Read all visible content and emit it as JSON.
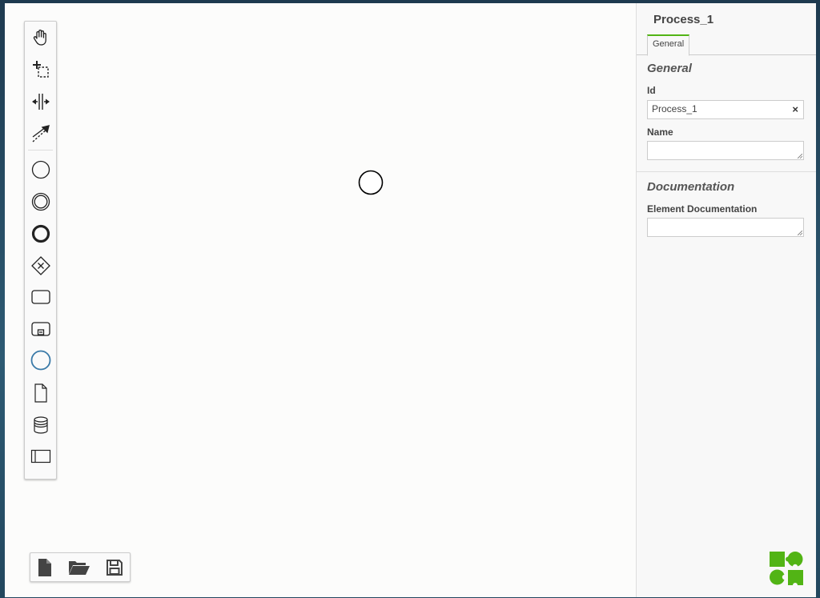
{
  "palette": {
    "tools": [
      {
        "name": "hand-tool",
        "icon": "hand-icon"
      },
      {
        "name": "lasso-tool",
        "icon": "lasso-icon"
      },
      {
        "name": "space-tool",
        "icon": "space-tool-icon"
      },
      {
        "name": "global-connect-tool",
        "icon": "connect-icon"
      },
      {
        "name": "create-start-event",
        "icon": "start-event-icon"
      },
      {
        "name": "create-intermediate-event",
        "icon": "intermediate-event-icon"
      },
      {
        "name": "create-end-event",
        "icon": "end-event-icon"
      },
      {
        "name": "create-gateway",
        "icon": "gateway-icon"
      },
      {
        "name": "create-task",
        "icon": "task-icon"
      },
      {
        "name": "create-subprocess",
        "icon": "subprocess-icon"
      },
      {
        "name": "create-participant",
        "icon": "participant-icon"
      },
      {
        "name": "create-data-object",
        "icon": "data-object-icon"
      },
      {
        "name": "create-data-store",
        "icon": "data-store-icon"
      },
      {
        "name": "create-group",
        "icon": "group-icon"
      }
    ]
  },
  "colors": {
    "accent": "#52b415",
    "participant_blue": "#3a7aa8",
    "logo_green": "#52b415"
  },
  "file_toolbar": {
    "buttons": [
      {
        "name": "new-diagram-button",
        "icon": "new-file-icon"
      },
      {
        "name": "open-diagram-button",
        "icon": "folder-open-icon"
      },
      {
        "name": "save-diagram-button",
        "icon": "save-icon"
      }
    ]
  },
  "properties_panel": {
    "title": "Process_1",
    "tabs": [
      {
        "label": "General",
        "active": true
      }
    ],
    "groups": {
      "general": {
        "title": "General",
        "id_label": "Id",
        "id_value": "Process_1",
        "clear_symbol": "×",
        "name_label": "Name",
        "name_value": ""
      },
      "documentation": {
        "title": "Documentation",
        "element_doc_label": "Element Documentation",
        "element_doc_value": ""
      }
    }
  }
}
